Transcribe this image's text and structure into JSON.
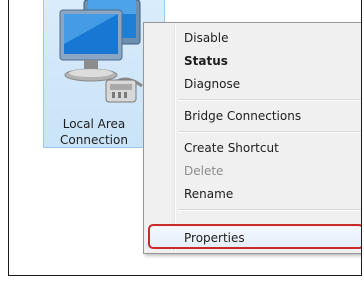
{
  "desktop": {
    "icon_name": "network-connection-icon",
    "label_line1": "Local Area",
    "label_line2": "Connection"
  },
  "context_menu": {
    "items": [
      {
        "label": "Disable",
        "bold": false,
        "disabled": false
      },
      {
        "label": "Status",
        "bold": true,
        "disabled": false
      },
      {
        "label": "Diagnose",
        "bold": false,
        "disabled": false
      },
      {
        "label": "Bridge Connections",
        "bold": false,
        "disabled": false
      },
      {
        "label": "Create Shortcut",
        "bold": false,
        "disabled": false
      },
      {
        "label": "Delete",
        "bold": false,
        "disabled": true
      },
      {
        "label": "Rename",
        "bold": false,
        "disabled": false
      },
      {
        "label": "Properties",
        "bold": false,
        "disabled": false,
        "highlighted": true
      }
    ]
  },
  "colors": {
    "highlight_outline": "#c92a2a",
    "tile_selection": "#cfe6f9"
  }
}
